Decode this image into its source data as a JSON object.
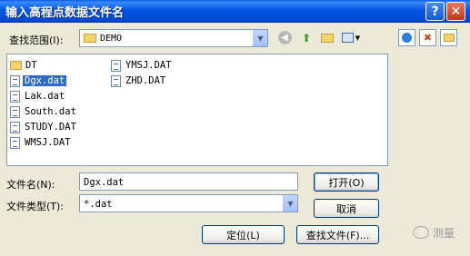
{
  "window": {
    "title": "输入高程点数据文件名",
    "help_label": "?",
    "close_label": "✕"
  },
  "lookin": {
    "label": "查找范围(I):",
    "value": "DEMO"
  },
  "toolbar": {
    "back_icon": "back-icon",
    "up_icon": "up-folder-icon",
    "new_folder_icon": "new-folder-icon",
    "views_icon": "views-menu-icon",
    "right_icons": [
      "search-web-icon",
      "delete-icon",
      "create-folder-icon"
    ]
  },
  "files": [
    {
      "name": "DT",
      "type": "folder"
    },
    {
      "name": "Dgx.dat",
      "type": "file",
      "selected": true
    },
    {
      "name": "Lak.dat",
      "type": "file"
    },
    {
      "name": "South.dat",
      "type": "file"
    },
    {
      "name": "STUDY.DAT",
      "type": "file"
    },
    {
      "name": "WMSJ.DAT",
      "type": "file"
    },
    {
      "name": "YMSJ.DAT",
      "type": "file"
    },
    {
      "name": "ZHD.DAT",
      "type": "file"
    }
  ],
  "filename": {
    "label": "文件名(N):",
    "value": "Dgx.dat"
  },
  "filetype": {
    "label": "文件类型(T):",
    "value": "*.dat"
  },
  "buttons": {
    "open": "打开(O)",
    "cancel": "取消",
    "locate": "定位(L)",
    "find_file": "查找文件(F)..."
  },
  "watermark": {
    "text": "测量"
  },
  "colors": {
    "titlebar": "#0054e3",
    "selection": "#316ac5",
    "dialog_bg": "#ece9d8"
  }
}
